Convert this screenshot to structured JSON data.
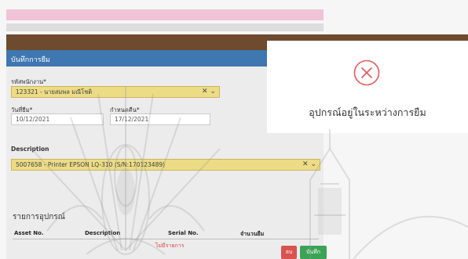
{
  "form": {
    "title": "บันทึกการยืม",
    "customer_label": "รหัสพนักงาน*",
    "customer_value": "123321 - นายสมพล มณีโชติ",
    "borrow_date_label": "วันที่ยืม*",
    "borrow_date_value": "10/12/2021",
    "due_date_label": "กำหนดคืน*",
    "due_date_value": "17/12/2021",
    "description_label": "Description",
    "description_value": "5007658 - Printer EPSON LQ-310 (S/N:170123489)",
    "section_title": "รายการอุปกรณ์",
    "columns": [
      "Asset No.",
      "Description",
      "Serial No.",
      "จำนวนยืม"
    ],
    "empty_note": "ไม่มีรายการ",
    "delete_label": "ลบ",
    "save_label": "บันทึก"
  },
  "modal": {
    "message": "อุปกรณ์อยู่ในระหว่างการยืม",
    "icon": "error-circle-x-icon",
    "icon_color": "#e05a5a"
  },
  "colors": {
    "header_blue": "#3f77b0",
    "top_bar_brown": "#6e4a2e",
    "select_yellow": "#ecdc86",
    "pink_bar": "#f0c4d6"
  }
}
